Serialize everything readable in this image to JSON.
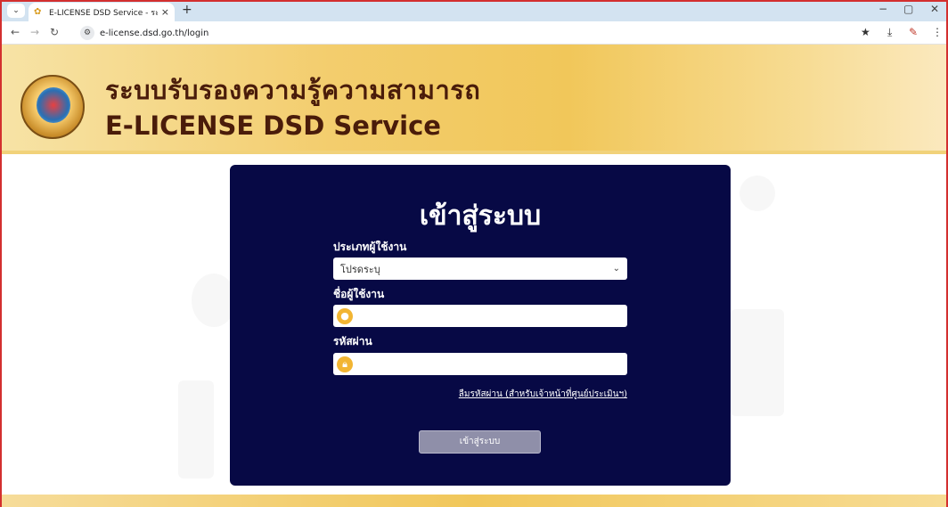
{
  "browser": {
    "tab_title": "E-LICENSE DSD Service - ระบบรั...",
    "tab_favicon": "dsd-favicon",
    "new_tab": "+",
    "url": "e-license.dsd.go.th/login"
  },
  "header": {
    "title_th": "ระบบรับรองความรู้ความสามารถ",
    "title_en": "E-LICENSE DSD Service",
    "logo_text": "กรมพัฒนาฝีมือแรงงาน"
  },
  "login": {
    "title": "เข้าสู่ระบบ",
    "user_type_label": "ประเภทผู้ใช้งาน",
    "user_type_selected": "โปรดระบุ",
    "username_label": "ชื่อผู้ใช้งาน",
    "username_value": "",
    "password_label": "รหัสผ่าน",
    "password_value": "",
    "forgot_link": "ลืมรหัสผ่าน (สำหรับเจ้าหน้าที่ศูนย์ประเมินฯ)",
    "submit_label": "เข้าสู่ระบบ"
  },
  "colors": {
    "panel_bg": "#070945",
    "header_gold": "#f1c75a",
    "brand_text": "#4a1c0a",
    "button_bg": "#8f8fa9"
  }
}
